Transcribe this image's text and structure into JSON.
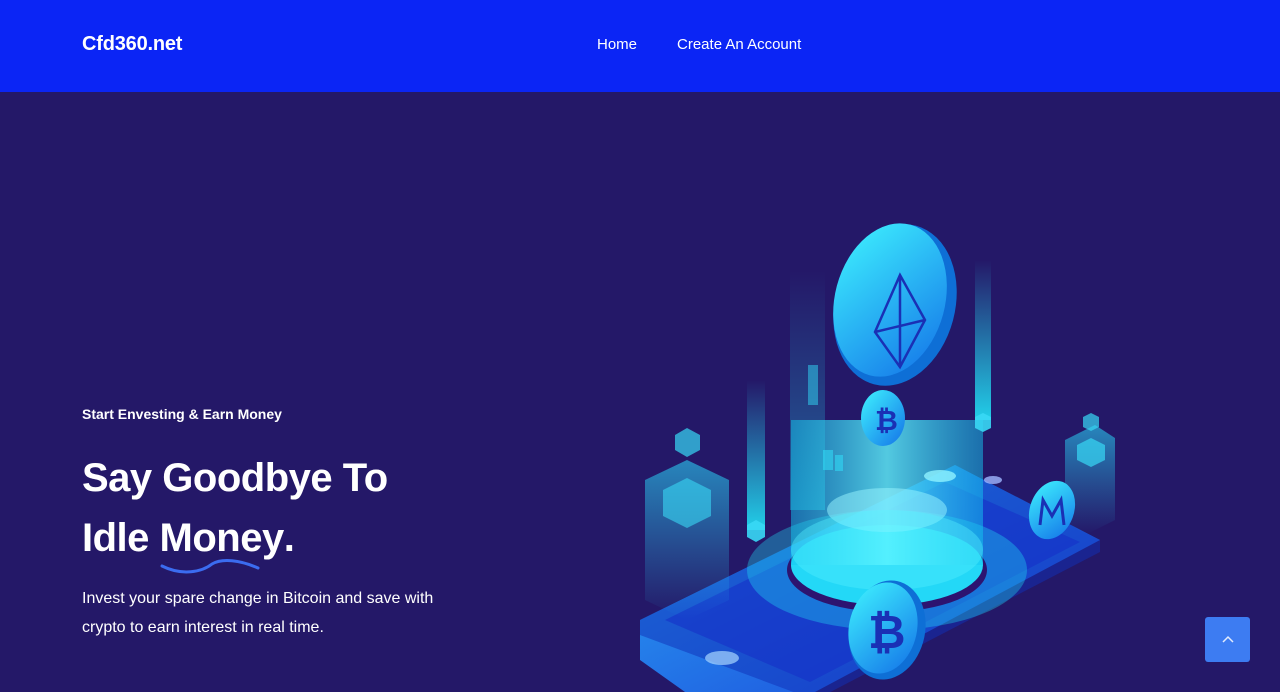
{
  "header": {
    "brand": "Cfd360.net",
    "nav": [
      {
        "label": "Home"
      },
      {
        "label": "Create An Account"
      }
    ]
  },
  "hero": {
    "eyebrow": "Start Envesting & Earn Money",
    "headline_line1": "Say Goodbye To",
    "headline_line2_prefix": "Idle ",
    "headline_accent": "Money",
    "headline_suffix": ".",
    "description": "Invest your spare change in Bitcoin and save with crypto to earn interest in real time."
  },
  "colors": {
    "header_bg": "#0b25f5",
    "page_bg": "#241868",
    "accent_cyan": "#22e3f7",
    "scroll_button": "#3d7cf2"
  },
  "icons": {
    "scroll_top": "chevron-up-icon",
    "coins": [
      "ethereum-coin-icon",
      "bitcoin-coin-icon",
      "monero-coin-icon"
    ]
  }
}
